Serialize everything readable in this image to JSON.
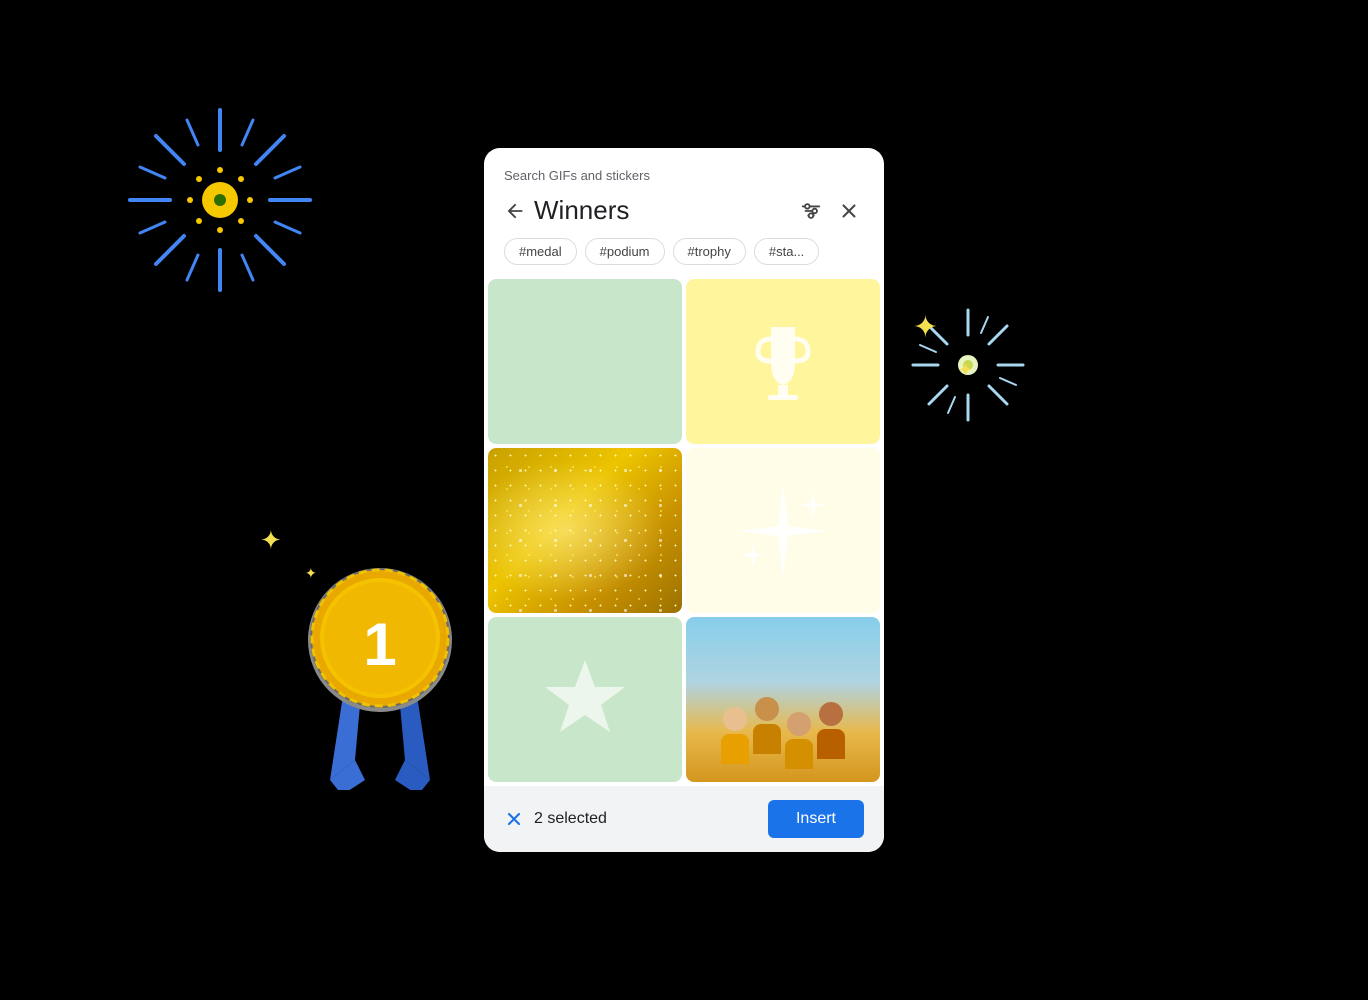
{
  "header": {
    "search_label": "Search GIFs and stickers",
    "title": "Winners",
    "back_label": "←",
    "filter_label": "⊞",
    "close_label": "✕"
  },
  "tags": [
    {
      "label": "#medal"
    },
    {
      "label": "#podium"
    },
    {
      "label": "#trophy"
    },
    {
      "label": "#sta..."
    }
  ],
  "grid": {
    "items": [
      {
        "id": "tile-mint",
        "type": "mint"
      },
      {
        "id": "tile-trophy",
        "type": "trophy"
      },
      {
        "id": "tile-gold",
        "type": "gold"
      },
      {
        "id": "tile-sparkles",
        "type": "sparkles"
      },
      {
        "id": "tile-star",
        "type": "star"
      },
      {
        "id": "tile-people",
        "type": "people"
      }
    ]
  },
  "bottom_bar": {
    "selected_count": "2 selected",
    "insert_label": "Insert"
  },
  "decorations": {
    "sparkle_char": "✦",
    "sparkle_small": "✦"
  }
}
